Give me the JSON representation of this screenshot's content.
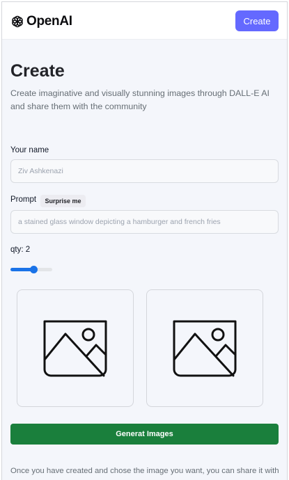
{
  "header": {
    "brand": "OpenAI",
    "create_button": "Create",
    "accent_color": "#6469ff"
  },
  "page": {
    "title": "Create",
    "subtitle": "Create imaginative and visually stunning images through DALL-E AI and share them with the community"
  },
  "form": {
    "name_label": "Your name",
    "name_placeholder": "Ziv Ashkenazi",
    "prompt_label": "Prompt",
    "surprise_button": "Surprise me",
    "prompt_placeholder": "a stained glass window depicting a hamburger and french fries",
    "qty_label": "qty: 2",
    "qty_value": 2,
    "qty_fraction": 0.55,
    "slider_color": "#1a73e8"
  },
  "previews": [
    {
      "icon": "image-placeholder-icon"
    },
    {
      "icon": "image-placeholder-icon"
    }
  ],
  "actions": {
    "generate_button": "Generat Images",
    "generate_color": "#1a7f3c"
  },
  "footer": {
    "note": "Once you have created and chose the image you want, you can share it with"
  }
}
